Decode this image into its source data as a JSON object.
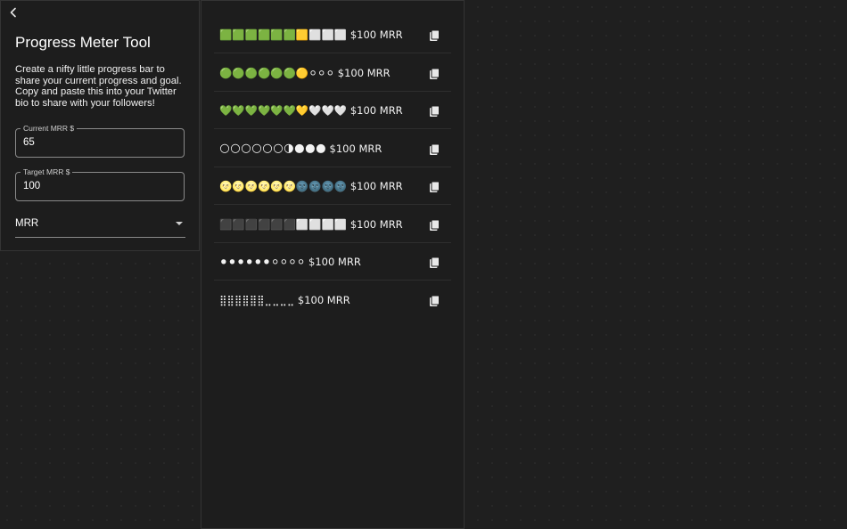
{
  "tool": {
    "title": "Progress Meter Tool",
    "description": "Create a nifty little progress bar to share your current progress and goal. Copy and paste this into your Twitter bio to share with your followers!",
    "back_icon": "chevron-left-icon"
  },
  "form": {
    "current": {
      "label": "Current MRR $",
      "value": "65"
    },
    "target": {
      "label": "Target MRR $",
      "value": "100"
    },
    "unit": {
      "selected": "MRR"
    }
  },
  "meters": [
    {
      "text": "🟩🟩🟩🟩🟩🟩🟨⬜⬜⬜ $100 MRR"
    },
    {
      "text": "🟢🟢🟢🟢🟢🟢🟡⚪⚪⚪ $100 MRR"
    },
    {
      "text": "💚💚💚💚💚💚💛🤍🤍🤍 $100 MRR"
    },
    {
      "text": "🌕🌕🌕🌕🌕🌕🌗🌑🌑🌑 $100 MRR"
    },
    {
      "text": "🌝🌝🌝🌝🌝🌝🌚🌚🌚🌚 $100 MRR"
    },
    {
      "text": "⬛⬛⬛⬛⬛⬛⬜⬜⬜⬜ $100 MRR"
    },
    {
      "text": "⚫⚫⚫⚫⚫⚫⚪⚪⚪⚪ $100 MRR"
    },
    {
      "text": "⣿⣿⣿⣿⣿⣿⣀⣀⣀⣀ $100 MRR"
    }
  ],
  "copy_icon": "copy-icon"
}
